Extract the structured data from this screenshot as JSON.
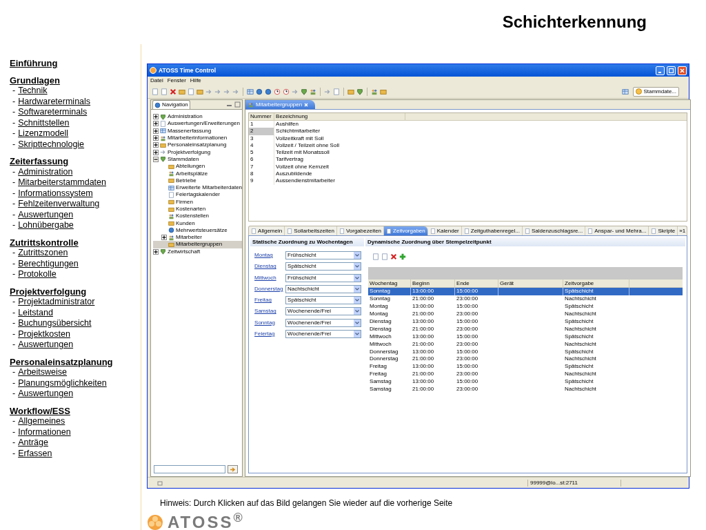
{
  "slide_title": "Schichterkennung",
  "sidebar": {
    "bullet": "-",
    "sections": [
      {
        "heading": "Einführung"
      },
      {
        "heading": "Grundlagen",
        "items": [
          "Technik",
          "Hardwareterminals",
          "Softwareterminals",
          "Schnittstellen",
          "Lizenzmodell",
          "Skripttechnologie"
        ]
      },
      {
        "heading": "Zeiterfassung",
        "items": [
          "Administration",
          "Mitarbeiterstammdaten",
          "Informationssystem",
          "Fehlzeitenverwaltung",
          "Auswertungen",
          "Lohnübergabe"
        ]
      },
      {
        "heading": "Zutrittskontrolle",
        "items": [
          "Zutrittszonen",
          "Berechtigungen",
          "Protokolle"
        ]
      },
      {
        "heading": "Projektverfolgung",
        "items": [
          "Projektadministrator",
          "Leitstand",
          "Buchungsübersicht",
          "Projektkosten",
          "Auswertungen"
        ]
      },
      {
        "heading": "Personaleinsatzplanung",
        "items": [
          "Arbeitsweise",
          "Planungsmöglichkeiten",
          "Auswertungen"
        ]
      },
      {
        "heading": "Workflow/ESS",
        "items": [
          "Allgemeines",
          "Informationen",
          "Anträge",
          "Erfassen"
        ]
      }
    ]
  },
  "window": {
    "title": "ATOSS Time Control",
    "menu": [
      "Datei",
      "Fenster",
      "Hilfe"
    ],
    "perspective_button": "Stammdate...",
    "navigation": {
      "title": "Navigation",
      "tree": [
        {
          "label": "Administration",
          "expanded": false,
          "selected": false
        },
        {
          "label": "Auswertungen/Erweiterungen",
          "expanded": false,
          "selected": false
        },
        {
          "label": "Massenerfassung",
          "expanded": false,
          "selected": false
        },
        {
          "label": "Mitarbeiterinformationen",
          "expanded": false,
          "selected": false
        },
        {
          "label": "Personaleinsatzplanung",
          "expanded": false,
          "selected": false
        },
        {
          "label": "Projektverfolgung",
          "expanded": false,
          "selected": false
        },
        {
          "label": "Stammdaten",
          "expanded": true,
          "selected": false,
          "children": [
            {
              "label": "Abteilungen",
              "selected": false
            },
            {
              "label": "Arbeitsplätze",
              "selected": false
            },
            {
              "label": "Betriebe",
              "selected": false
            },
            {
              "label": "Erweiterte Mitarbeiterdaten",
              "selected": false
            },
            {
              "label": "Feiertagskalender",
              "selected": false
            },
            {
              "label": "Firmen",
              "selected": false
            },
            {
              "label": "Kostenarten",
              "selected": false
            },
            {
              "label": "Kostenstellen",
              "selected": false
            },
            {
              "label": "Kunden",
              "selected": false
            },
            {
              "label": "Mehrwertsteuersätze",
              "selected": false
            },
            {
              "label": "Mitarbeiter",
              "expanded": false,
              "selected": false
            },
            {
              "label": "Mitarbeitergruppen",
              "selected": true
            }
          ]
        },
        {
          "label": "Zeitwirtschaft",
          "expanded": false,
          "selected": false
        }
      ]
    },
    "editor_tab": "Mitarbeitergruppen",
    "groups_table": {
      "columns": [
        "Nummer",
        "Bezeichnung"
      ],
      "rows": [
        {
          "cells": [
            "1",
            "Aushilfen"
          ],
          "selected": false
        },
        {
          "cells": [
            "2",
            "Schichtmitarbeiter"
          ],
          "selected": true
        },
        {
          "cells": [
            "3",
            "Vollzeitkraft mit Soll"
          ],
          "selected": false
        },
        {
          "cells": [
            "4",
            "Vollzeit / Teilzeit ohne Soll"
          ],
          "selected": false
        },
        {
          "cells": [
            "5",
            "Teilzeit mit Monatssoll"
          ],
          "selected": false
        },
        {
          "cells": [
            "6",
            "Tarifvertrag"
          ],
          "selected": false
        },
        {
          "cells": [
            "7",
            "Vollzeit ohne Kernzeit"
          ],
          "selected": false
        },
        {
          "cells": [
            "8",
            "Auszubildende"
          ],
          "selected": false
        },
        {
          "cells": [
            "9",
            "Aussendienstmitarbeiter"
          ],
          "selected": false
        }
      ]
    },
    "tabs": [
      {
        "label": "Allgemein",
        "selected": false
      },
      {
        "label": "Sollarbeitszeiten",
        "selected": false
      },
      {
        "label": "Vorgabezeiten",
        "selected": false
      },
      {
        "label": "Zeitvorgaben",
        "selected": true
      },
      {
        "label": "Kalender",
        "selected": false
      },
      {
        "label": "Zeitguthabenregel...",
        "selected": false
      },
      {
        "label": "Saldenzuschlagsre...",
        "selected": false
      },
      {
        "label": "Anspar- und Mehra...",
        "selected": false
      },
      {
        "label": "Skripte",
        "selected": false
      }
    ],
    "tabs_overflow": "»1",
    "static": {
      "title": "Statische Zuordnung zu Wochentagen",
      "days": [
        {
          "day": "Montag",
          "value": "Frühschicht"
        },
        {
          "day": "Dienstag",
          "value": "Spätschicht"
        },
        {
          "day": "Mittwoch",
          "value": "Frühschicht"
        },
        {
          "day": "Donnerstag",
          "value": "Nachtschicht"
        },
        {
          "day": "Freitag",
          "value": "Spätschicht"
        },
        {
          "day": "Samstag",
          "value": "Wochenende/Frei"
        },
        {
          "day": "Sonntag",
          "value": "Wochenende/Frei"
        },
        {
          "day": "Feiertag",
          "value": "Wochenende/Frei"
        }
      ]
    },
    "dynamic": {
      "title": "Dynamische Zuordnung über Stempelzeitpunkt",
      "columns": [
        "Wochentag",
        "Beginn",
        "Ende",
        "Gerät",
        "Zeitvorgabe"
      ],
      "rows": [
        {
          "cells": [
            "Sonntag",
            "13:00:00",
            "15:00:00",
            "",
            "Spätschicht"
          ],
          "selected": true
        },
        {
          "cells": [
            "Sonntag",
            "21:00:00",
            "23:00:00",
            "",
            "Nachtschicht"
          ],
          "selected": false
        },
        {
          "cells": [
            "Montag",
            "13:00:00",
            "15:00:00",
            "",
            "Spätschicht"
          ],
          "selected": false
        },
        {
          "cells": [
            "Montag",
            "21:00:00",
            "23:00:00",
            "",
            "Nachtschicht"
          ],
          "selected": false
        },
        {
          "cells": [
            "Dienstag",
            "13:00:00",
            "15:00:00",
            "",
            "Spätschicht"
          ],
          "selected": false
        },
        {
          "cells": [
            "Dienstag",
            "21:00:00",
            "23:00:00",
            "",
            "Nachtschicht"
          ],
          "selected": false
        },
        {
          "cells": [
            "Mittwoch",
            "13:00:00",
            "15:00:00",
            "",
            "Spätschicht"
          ],
          "selected": false
        },
        {
          "cells": [
            "Mittwoch",
            "21:00:00",
            "23:00:00",
            "",
            "Nachtschicht"
          ],
          "selected": false
        },
        {
          "cells": [
            "Donnerstag",
            "13:00:00",
            "15:00:00",
            "",
            "Spätschicht"
          ],
          "selected": false
        },
        {
          "cells": [
            "Donnerstag",
            "21:00:00",
            "23:00:00",
            "",
            "Nachtschicht"
          ],
          "selected": false
        },
        {
          "cells": [
            "Freitag",
            "13:00:00",
            "15:00:00",
            "",
            "Spätschicht"
          ],
          "selected": false
        },
        {
          "cells": [
            "Freitag",
            "21:00:00",
            "23:00:00",
            "",
            "Nachtschicht"
          ],
          "selected": false
        },
        {
          "cells": [
            "Samstag",
            "13:00:00",
            "15:00:00",
            "",
            "Spätschicht"
          ],
          "selected": false
        },
        {
          "cells": [
            "Samstag",
            "21:00:00",
            "23:00:00",
            "",
            "Nachtschicht"
          ],
          "selected": false
        }
      ]
    },
    "status_bar": {
      "connection": "99999@lo...st:2711"
    }
  },
  "hint": "Hinweis: Durch Klicken auf das Bild gelangen Sie wieder auf die vorherige Seite",
  "logo": "ATOSS$^{®}$"
}
